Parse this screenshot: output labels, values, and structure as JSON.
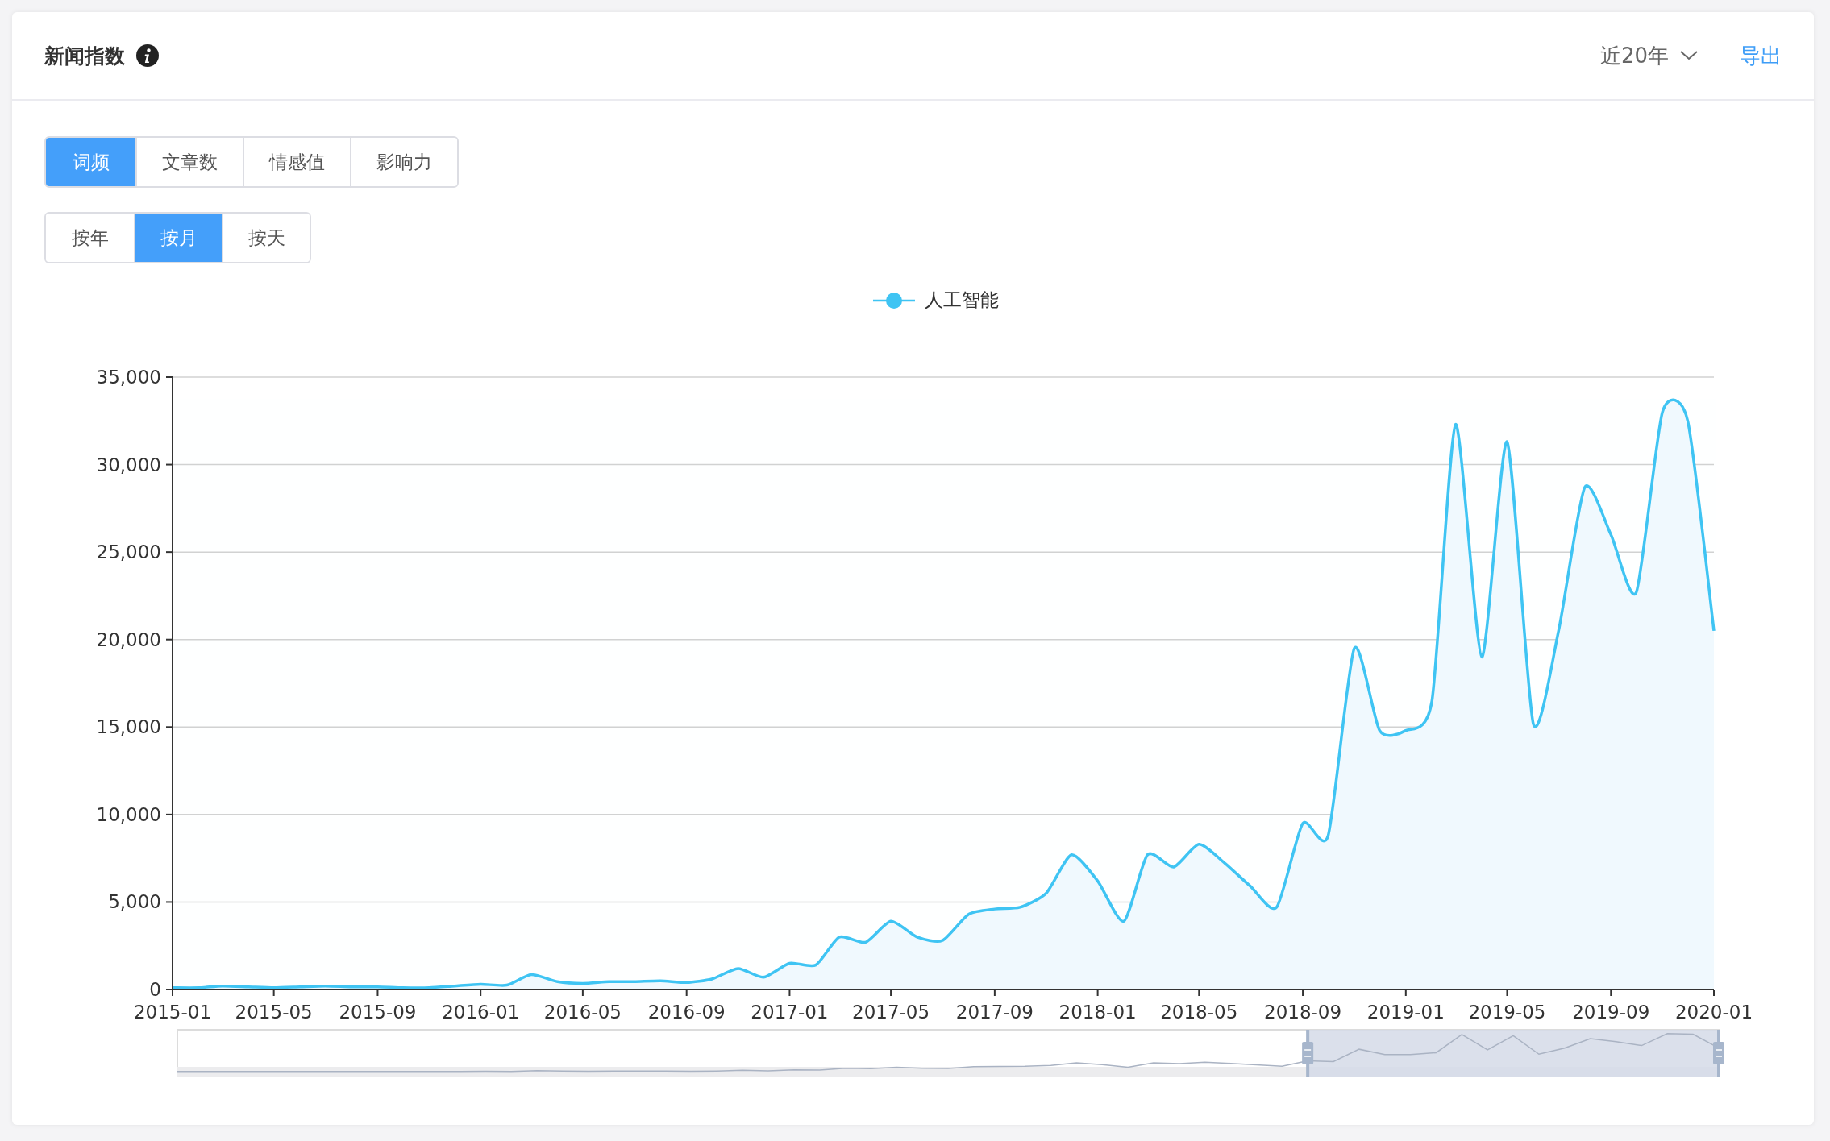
{
  "header": {
    "title": "新闻指数",
    "range_select": {
      "value": "近20年"
    },
    "export_link": "导出"
  },
  "metric_tabs": [
    {
      "label": "词频",
      "selected": true
    },
    {
      "label": "文章数",
      "selected": false
    },
    {
      "label": "情感值",
      "selected": false
    },
    {
      "label": "影响力",
      "selected": false
    }
  ],
  "granularity_tabs": [
    {
      "label": "按年",
      "selected": false
    },
    {
      "label": "按月",
      "selected": true
    },
    {
      "label": "按天",
      "selected": false
    }
  ],
  "chart": {
    "chart_data": {
      "type": "area",
      "x": [
        "2015-01",
        "2015-02",
        "2015-03",
        "2015-04",
        "2015-05",
        "2015-06",
        "2015-07",
        "2015-08",
        "2015-09",
        "2015-10",
        "2015-11",
        "2015-12",
        "2016-01",
        "2016-02",
        "2016-03",
        "2016-04",
        "2016-05",
        "2016-06",
        "2016-07",
        "2016-08",
        "2016-09",
        "2016-10",
        "2016-11",
        "2016-12",
        "2017-01",
        "2017-02",
        "2017-03",
        "2017-04",
        "2017-05",
        "2017-06",
        "2017-07",
        "2017-08",
        "2017-09",
        "2017-10",
        "2017-11",
        "2017-12",
        "2018-01",
        "2018-02",
        "2018-03",
        "2018-04",
        "2018-05",
        "2018-06",
        "2018-07",
        "2018-08",
        "2018-09",
        "2018-10",
        "2018-11",
        "2018-12",
        "2019-01",
        "2019-02",
        "2019-03",
        "2019-04",
        "2019-05",
        "2019-06",
        "2019-07",
        "2019-08",
        "2019-09",
        "2019-10",
        "2019-11",
        "2019-12",
        "2020-01"
      ],
      "series": [
        {
          "name": "人工智能",
          "color": "#3fc4f3",
          "values": [
            100,
            100,
            200,
            150,
            100,
            150,
            200,
            150,
            150,
            100,
            100,
            200,
            300,
            250,
            850,
            450,
            350,
            450,
            450,
            500,
            400,
            600,
            1200,
            700,
            1500,
            1400,
            3000,
            2700,
            3900,
            3000,
            2800,
            4300,
            4600,
            4700,
            5500,
            7700,
            6200,
            3900,
            7700,
            7000,
            8300,
            7200,
            5900,
            4700,
            9500,
            8800,
            19500,
            14800,
            14800,
            16500,
            32300,
            19000,
            31300,
            15200,
            20500,
            28700,
            26000,
            22700,
            33000,
            32500,
            20500
          ]
        }
      ],
      "grid": true,
      "xlim": [
        "2015-01",
        "2020-01"
      ],
      "ylim": [
        0,
        35000
      ],
      "xticks": [
        "2015-01",
        "2015-05",
        "2015-09",
        "2016-01",
        "2016-05",
        "2016-09",
        "2017-01",
        "2017-05",
        "2017-09",
        "2018-01",
        "2018-05",
        "2018-09",
        "2019-01",
        "2019-05",
        "2019-09",
        "2020-01"
      ],
      "yticks": [
        {
          "value": 0,
          "label": "0"
        },
        {
          "value": 5000,
          "label": "5,000"
        },
        {
          "value": 10000,
          "label": "10,000"
        },
        {
          "value": 15000,
          "label": "15,000"
        },
        {
          "value": 20000,
          "label": "20,000"
        },
        {
          "value": 25000,
          "label": "25,000"
        },
        {
          "value": 30000,
          "label": "30,000"
        },
        {
          "value": 35000,
          "label": "35,000"
        }
      ]
    }
  }
}
